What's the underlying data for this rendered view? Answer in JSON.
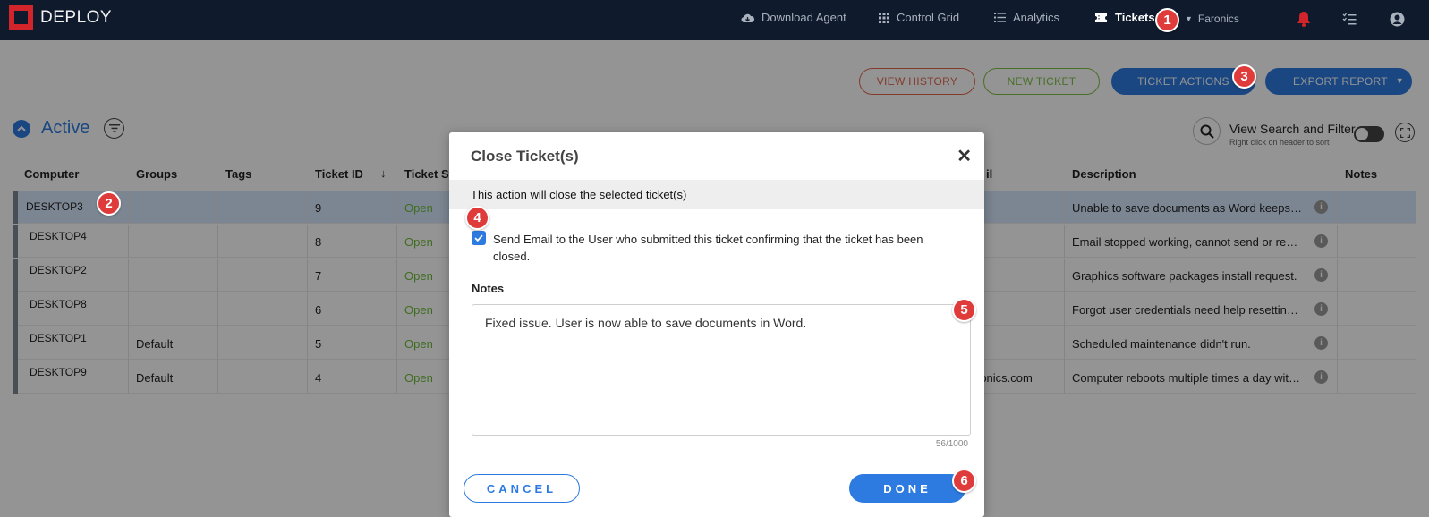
{
  "app": {
    "logo_text": "DEPLOY"
  },
  "nav": {
    "download_agent": "Download Agent",
    "control_grid": "Control Grid",
    "analytics": "Analytics",
    "tickets": "Tickets",
    "account": "Faronics"
  },
  "steps": [
    "1",
    "2",
    "3",
    "4",
    "5",
    "6"
  ],
  "toolbar": {
    "view_history": "VIEW HISTORY",
    "new_ticket": "NEW TICKET",
    "ticket_actions": "TICKET ACTIONS",
    "export_report": "EXPORT REPORT"
  },
  "section": {
    "title": "Active",
    "view_search_filter": "View Search and Filter",
    "sort_hint": "Right click on header to sort"
  },
  "table": {
    "headers": {
      "computer": "Computer",
      "groups": "Groups",
      "tags": "Tags",
      "ticket_id": "Ticket ID",
      "ticket_status": "Ticket St",
      "email": "il",
      "description": "Description",
      "notes": "Notes"
    },
    "rows": [
      {
        "computer": "DESKTOP3",
        "groups": "",
        "ticket_id": "9",
        "status": "Open",
        "email": "",
        "description": "Unable to save documents as Word keeps crashing"
      },
      {
        "computer": "DESKTOP4",
        "groups": "",
        "ticket_id": "8",
        "status": "Open",
        "email": "",
        "description": "Email stopped working, cannot send or receive"
      },
      {
        "computer": "DESKTOP2",
        "groups": "",
        "ticket_id": "7",
        "status": "Open",
        "email": "",
        "description": "Graphics software packages install request."
      },
      {
        "computer": "DESKTOP8",
        "groups": "",
        "ticket_id": "6",
        "status": "Open",
        "email": "",
        "description": "Forgot user credentials need help resetting password"
      },
      {
        "computer": "DESKTOP1",
        "groups": "Default",
        "ticket_id": "5",
        "status": "Open",
        "email": "",
        "description": "Scheduled maintenance didn't run."
      },
      {
        "computer": "DESKTOP9",
        "groups": "Default",
        "ticket_id": "4",
        "status": "Open",
        "email": "ronics.com",
        "description": "Computer reboots multiple times a day without warning"
      }
    ]
  },
  "modal": {
    "title": "Close Ticket(s)",
    "band_text": "This action will close the selected ticket(s)",
    "send_email_label": "Send Email to the User who submitted this ticket confirming that the ticket has been closed.",
    "send_email_checked": true,
    "notes_label": "Notes",
    "notes_value": "Fixed issue. User is now able to save documents in Word.",
    "counter": "56/1000",
    "cancel": "CANCEL",
    "done": "DONE"
  },
  "colors": {
    "accent": "#2d7be0",
    "badge": "#e03b3b",
    "open_status": "#6fbb3a",
    "topbar": "#0f1a2c"
  }
}
